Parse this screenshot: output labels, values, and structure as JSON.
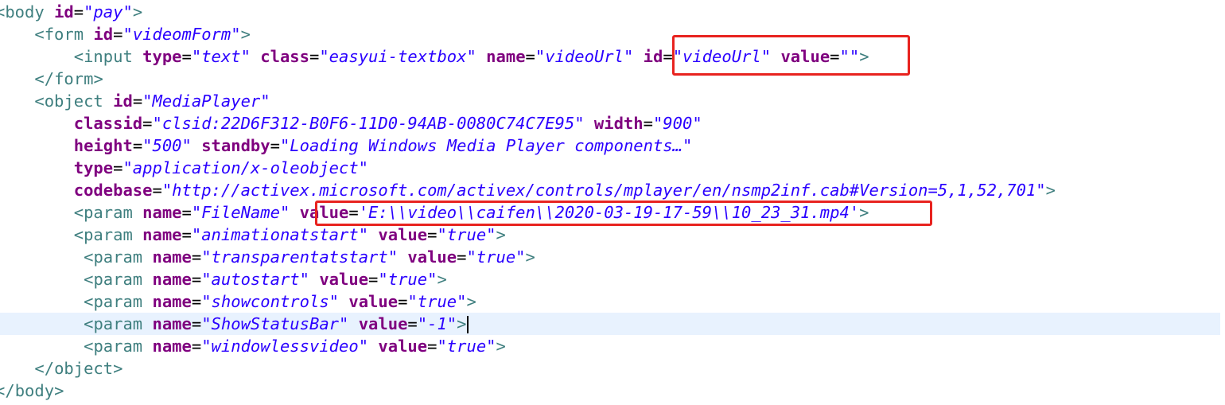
{
  "code_lines": [
    {
      "tokens": [
        {
          "t": "tag",
          "v": "<"
        },
        {
          "t": "tn",
          "v": "body"
        },
        {
          "t": "txt",
          "v": " "
        },
        {
          "t": "attr",
          "v": "id"
        },
        {
          "t": "eq",
          "v": "="
        },
        {
          "t": "val",
          "v": "\"pay\""
        },
        {
          "t": "tag",
          "v": ">"
        }
      ]
    },
    {
      "tokens": [
        {
          "t": "txt",
          "v": "    "
        },
        {
          "t": "tag",
          "v": "<"
        },
        {
          "t": "tn",
          "v": "form"
        },
        {
          "t": "txt",
          "v": " "
        },
        {
          "t": "attr",
          "v": "id"
        },
        {
          "t": "eq",
          "v": "="
        },
        {
          "t": "val",
          "v": "\"videomForm\""
        },
        {
          "t": "tag",
          "v": ">"
        }
      ]
    },
    {
      "tokens": [
        {
          "t": "txt",
          "v": "        "
        },
        {
          "t": "tag",
          "v": "<"
        },
        {
          "t": "tn",
          "v": "input"
        },
        {
          "t": "txt",
          "v": " "
        },
        {
          "t": "attr",
          "v": "type"
        },
        {
          "t": "eq",
          "v": "="
        },
        {
          "t": "val",
          "v": "\"text\""
        },
        {
          "t": "txt",
          "v": " "
        },
        {
          "t": "attr",
          "v": "class"
        },
        {
          "t": "eq",
          "v": "="
        },
        {
          "t": "val",
          "v": "\"easyui-textbox\""
        },
        {
          "t": "txt",
          "v": " "
        },
        {
          "t": "attr",
          "v": "name"
        },
        {
          "t": "eq",
          "v": "="
        },
        {
          "t": "val",
          "v": "\"videoUrl\""
        },
        {
          "t": "txt",
          "v": " "
        },
        {
          "t": "attr",
          "v": "id"
        },
        {
          "t": "eq",
          "v": "="
        },
        {
          "t": "val",
          "v": "\"videoUrl\""
        },
        {
          "t": "txt",
          "v": " "
        },
        {
          "t": "attr",
          "v": "value"
        },
        {
          "t": "eq",
          "v": "="
        },
        {
          "t": "val",
          "v": "\"\""
        },
        {
          "t": "tag",
          "v": ">"
        }
      ]
    },
    {
      "tokens": [
        {
          "t": "txt",
          "v": "    "
        },
        {
          "t": "tag",
          "v": "</"
        },
        {
          "t": "tn",
          "v": "form"
        },
        {
          "t": "tag",
          "v": ">"
        }
      ]
    },
    {
      "tokens": [
        {
          "t": "txt",
          "v": "    "
        },
        {
          "t": "tag",
          "v": "<"
        },
        {
          "t": "tn",
          "v": "object"
        },
        {
          "t": "txt",
          "v": " "
        },
        {
          "t": "attr",
          "v": "id"
        },
        {
          "t": "eq",
          "v": "="
        },
        {
          "t": "val",
          "v": "\"MediaPlayer\""
        }
      ]
    },
    {
      "tokens": [
        {
          "t": "txt",
          "v": "        "
        },
        {
          "t": "attr",
          "v": "classid"
        },
        {
          "t": "eq",
          "v": "="
        },
        {
          "t": "val",
          "v": "\"clsid:22D6F312-B0F6-11D0-94AB-0080C74C7E95\""
        },
        {
          "t": "txt",
          "v": " "
        },
        {
          "t": "attr",
          "v": "width"
        },
        {
          "t": "eq",
          "v": "="
        },
        {
          "t": "val",
          "v": "\"900\""
        }
      ]
    },
    {
      "tokens": [
        {
          "t": "txt",
          "v": "        "
        },
        {
          "t": "attr",
          "v": "height"
        },
        {
          "t": "eq",
          "v": "="
        },
        {
          "t": "val",
          "v": "\"500\""
        },
        {
          "t": "txt",
          "v": " "
        },
        {
          "t": "attr",
          "v": "standby"
        },
        {
          "t": "eq",
          "v": "="
        },
        {
          "t": "val",
          "v": "\"Loading Windows Media Player components…\""
        }
      ]
    },
    {
      "tokens": [
        {
          "t": "txt",
          "v": "        "
        },
        {
          "t": "attr",
          "v": "type"
        },
        {
          "t": "eq",
          "v": "="
        },
        {
          "t": "val",
          "v": "\"application/x-oleobject\""
        }
      ]
    },
    {
      "tokens": [
        {
          "t": "txt",
          "v": "        "
        },
        {
          "t": "attr",
          "v": "codebase"
        },
        {
          "t": "eq",
          "v": "="
        },
        {
          "t": "val",
          "v": "\"http://activex.microsoft.com/activex/controls/mplayer/en/nsmp2inf.cab#Version=5,1,52,701\""
        },
        {
          "t": "tag",
          "v": ">"
        }
      ]
    },
    {
      "tokens": [
        {
          "t": "txt",
          "v": "        "
        },
        {
          "t": "tag",
          "v": "<"
        },
        {
          "t": "tn",
          "v": "param"
        },
        {
          "t": "txt",
          "v": " "
        },
        {
          "t": "attr",
          "v": "name"
        },
        {
          "t": "eq",
          "v": "="
        },
        {
          "t": "val",
          "v": "\"FileName\""
        },
        {
          "t": "txt",
          "v": " "
        },
        {
          "t": "attr",
          "v": "value"
        },
        {
          "t": "eq",
          "v": "="
        },
        {
          "t": "val",
          "v": "'E:\\\\video\\\\caifen\\\\2020-03-19-17-59\\\\10_23_31.mp4'"
        },
        {
          "t": "tag",
          "v": ">"
        }
      ]
    },
    {
      "tokens": [
        {
          "t": "txt",
          "v": "        "
        },
        {
          "t": "tag",
          "v": "<"
        },
        {
          "t": "tn",
          "v": "param"
        },
        {
          "t": "txt",
          "v": " "
        },
        {
          "t": "attr",
          "v": "name"
        },
        {
          "t": "eq",
          "v": "="
        },
        {
          "t": "val",
          "v": "\"animationatstart\""
        },
        {
          "t": "txt",
          "v": " "
        },
        {
          "t": "attr",
          "v": "value"
        },
        {
          "t": "eq",
          "v": "="
        },
        {
          "t": "val",
          "v": "\"true\""
        },
        {
          "t": "tag",
          "v": ">"
        }
      ]
    },
    {
      "tokens": [
        {
          "t": "txt",
          "v": "         "
        },
        {
          "t": "tag",
          "v": "<"
        },
        {
          "t": "tn",
          "v": "param"
        },
        {
          "t": "txt",
          "v": " "
        },
        {
          "t": "attr",
          "v": "name"
        },
        {
          "t": "eq",
          "v": "="
        },
        {
          "t": "val",
          "v": "\"transparentatstart\""
        },
        {
          "t": "txt",
          "v": " "
        },
        {
          "t": "attr",
          "v": "value"
        },
        {
          "t": "eq",
          "v": "="
        },
        {
          "t": "val",
          "v": "\"true\""
        },
        {
          "t": "tag",
          "v": ">"
        }
      ]
    },
    {
      "tokens": [
        {
          "t": "txt",
          "v": "         "
        },
        {
          "t": "tag",
          "v": "<"
        },
        {
          "t": "tn",
          "v": "param"
        },
        {
          "t": "txt",
          "v": " "
        },
        {
          "t": "attr",
          "v": "name"
        },
        {
          "t": "eq",
          "v": "="
        },
        {
          "t": "val",
          "v": "\"autostart\""
        },
        {
          "t": "txt",
          "v": " "
        },
        {
          "t": "attr",
          "v": "value"
        },
        {
          "t": "eq",
          "v": "="
        },
        {
          "t": "val",
          "v": "\"true\""
        },
        {
          "t": "tag",
          "v": ">"
        }
      ]
    },
    {
      "tokens": [
        {
          "t": "txt",
          "v": "         "
        },
        {
          "t": "tag",
          "v": "<"
        },
        {
          "t": "tn",
          "v": "param"
        },
        {
          "t": "txt",
          "v": " "
        },
        {
          "t": "attr",
          "v": "name"
        },
        {
          "t": "eq",
          "v": "="
        },
        {
          "t": "val",
          "v": "\"showcontrols\""
        },
        {
          "t": "txt",
          "v": " "
        },
        {
          "t": "attr",
          "v": "value"
        },
        {
          "t": "eq",
          "v": "="
        },
        {
          "t": "val",
          "v": "\"true\""
        },
        {
          "t": "tag",
          "v": ">"
        }
      ]
    },
    {
      "current": true,
      "tokens": [
        {
          "t": "txt",
          "v": "         "
        },
        {
          "t": "tag",
          "v": "<"
        },
        {
          "t": "tn",
          "v": "param"
        },
        {
          "t": "txt",
          "v": " "
        },
        {
          "t": "attr",
          "v": "name"
        },
        {
          "t": "eq",
          "v": "="
        },
        {
          "t": "val",
          "v": "\"ShowStatusBar\""
        },
        {
          "t": "txt",
          "v": " "
        },
        {
          "t": "attr",
          "v": "value"
        },
        {
          "t": "eq",
          "v": "="
        },
        {
          "t": "val",
          "v": "\"-1\""
        },
        {
          "t": "tag",
          "v": ">"
        }
      ]
    },
    {
      "tokens": [
        {
          "t": "txt",
          "v": "         "
        },
        {
          "t": "tag",
          "v": "<"
        },
        {
          "t": "tn",
          "v": "param"
        },
        {
          "t": "txt",
          "v": " "
        },
        {
          "t": "attr",
          "v": "name"
        },
        {
          "t": "eq",
          "v": "="
        },
        {
          "t": "val",
          "v": "\"windowlessvideo\""
        },
        {
          "t": "txt",
          "v": " "
        },
        {
          "t": "attr",
          "v": "value"
        },
        {
          "t": "eq",
          "v": "="
        },
        {
          "t": "val",
          "v": "\"true\""
        },
        {
          "t": "tag",
          "v": ">"
        }
      ]
    },
    {
      "tokens": [
        {
          "t": "txt",
          "v": "    "
        },
        {
          "t": "tag",
          "v": "</"
        },
        {
          "t": "tn",
          "v": "object"
        },
        {
          "t": "tag",
          "v": ">"
        }
      ]
    },
    {
      "tokens": [
        {
          "t": "tag",
          "v": "</"
        },
        {
          "t": "tn",
          "v": "body"
        },
        {
          "t": "tag",
          "v": ">"
        }
      ]
    }
  ],
  "colors": {
    "tag": "#3f7f7f",
    "attribute": "#7f007f",
    "value": "#2a00ff",
    "current_line_bg": "#e8f2fe",
    "highlight_box": "#e8231f"
  }
}
